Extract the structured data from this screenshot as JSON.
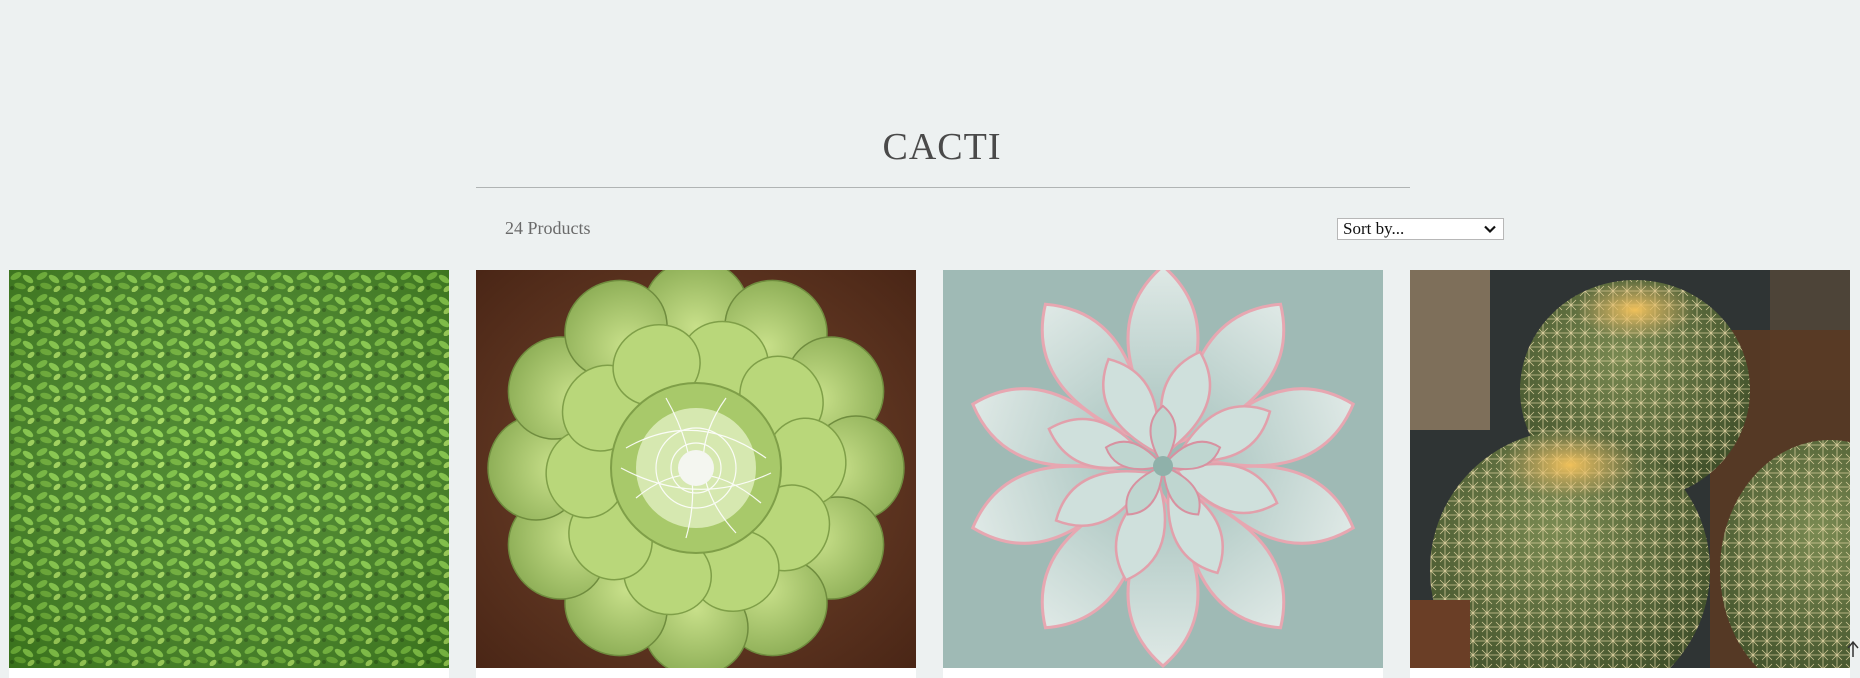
{
  "collection": {
    "title": "CACTI",
    "product_count": "24 Products",
    "sort": {
      "selected": "Sort by..."
    }
  },
  "products": [
    {
      "image": "green-sedum-groundcover"
    },
    {
      "image": "cobweb-houseleek-rosette"
    },
    {
      "image": "echeveria-pink-edge-rosette"
    },
    {
      "image": "golden-barrel-cactus"
    }
  ],
  "icons": {
    "sort_chevron": "chevron-down-icon",
    "back_to_top": "arrow-up-icon"
  },
  "colors": {
    "background": "#edf1f1",
    "title": "#4a4a4a",
    "muted_text": "#6a6a6a"
  }
}
